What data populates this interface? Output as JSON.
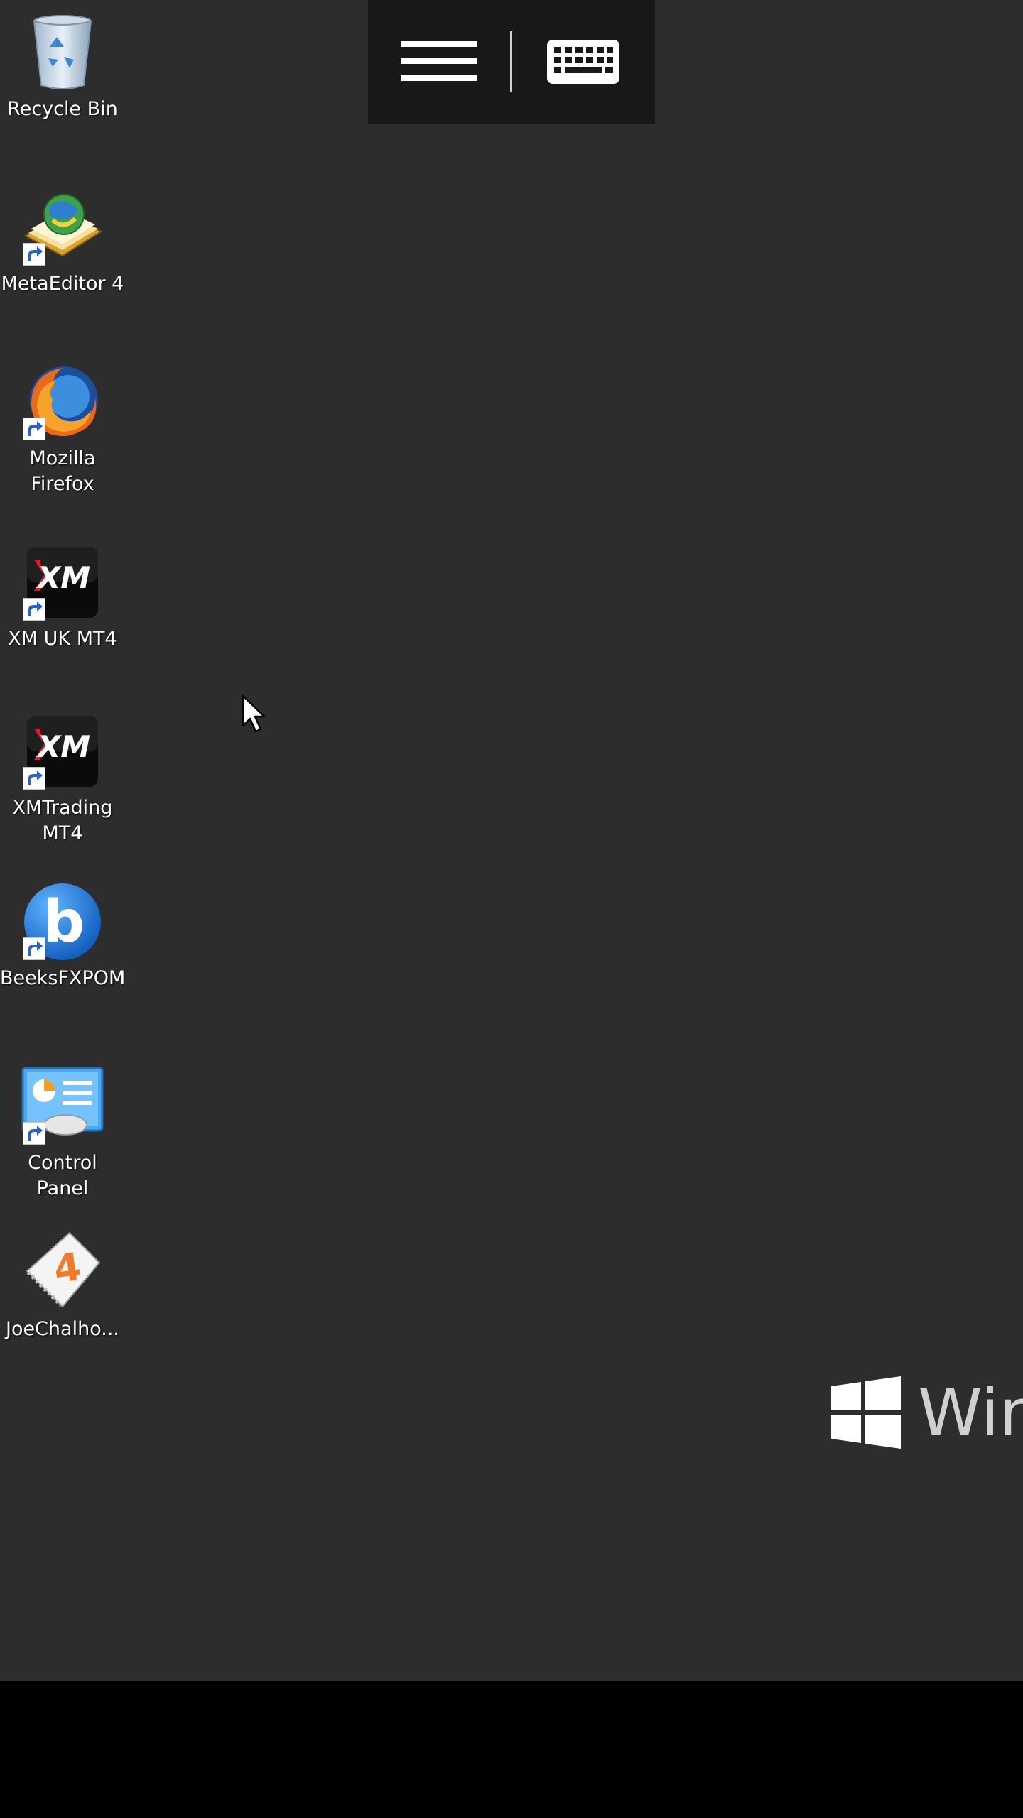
{
  "desktop": {
    "icons": [
      {
        "label": "Recycle Bin",
        "icon": "recycle-bin-icon"
      },
      {
        "label": "MetaEditor 4",
        "icon": "metaeditor-icon"
      },
      {
        "label": "Mozilla\nFirefox",
        "icon": "firefox-icon"
      },
      {
        "label": "XM UK MT4",
        "icon": "xm-icon"
      },
      {
        "label": "XMTrading\nMT4",
        "icon": "xm-icon"
      },
      {
        "label": "BeeksFXPOM",
        "icon": "beeks-icon"
      },
      {
        "label": "Control\nPanel",
        "icon": "control-panel-icon"
      },
      {
        "label": "JoeChalho...",
        "icon": "mq4-file-icon"
      }
    ],
    "xm_logo_text": "XM",
    "beeks_logo_text": "b",
    "mq4_logo_text": "4",
    "watermark_text": "Win"
  },
  "toolbar": {
    "menu_icon": "hamburger-menu-icon",
    "keyboard_icon": "keyboard-icon"
  },
  "colors": {
    "desktop_bg": "#2d2d2d",
    "toolbar_bg": "#181818",
    "bottom_bar": "#000000"
  }
}
